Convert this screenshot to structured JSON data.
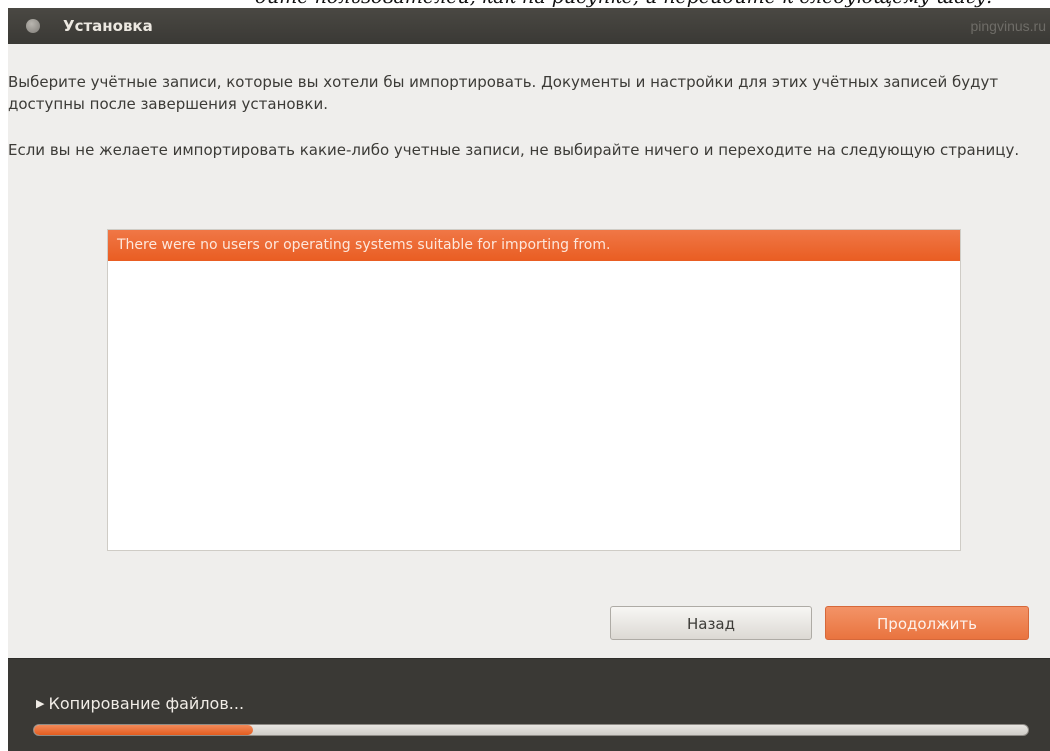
{
  "top_caption": "дите пользователей, как на рисунке, и перейдите к следующему шагу.",
  "window": {
    "title": "Установка",
    "watermark": "pingvinus.ru"
  },
  "content": {
    "paragraph_1": "Выберите учётные записи, которые вы хотели бы импортировать. Документы и настройки для этих учётных записей будут доступны после завершения установки.",
    "paragraph_2": "Если вы не желаете импортировать какие-либо учетные записи, не выбирайте ничего и переходите на следующую страницу.",
    "import_list": {
      "rows": [
        {
          "text": "There were no users or operating systems suitable for importing from.",
          "selected": true
        }
      ]
    }
  },
  "buttons": {
    "back_label": "Назад",
    "continue_label": "Продолжить"
  },
  "progress": {
    "label": "Копирование файлов...",
    "fraction": 0.22
  },
  "colors": {
    "accent": "#e95d22",
    "titlebar": "#3c3b37",
    "window_bg": "#efeeec"
  }
}
